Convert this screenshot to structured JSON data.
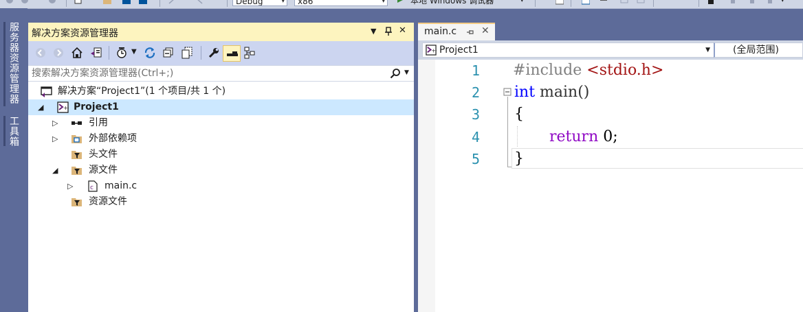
{
  "toolbar": {
    "config": "Debug",
    "platform": "x86",
    "debugger": "本地 Windows 调试器"
  },
  "left_strip": {
    "server_explorer": "服务器资源管理器",
    "toolbox": "工具箱"
  },
  "solution_explorer": {
    "title": "解决方案资源管理器",
    "search_placeholder": "搜索解决方案资源管理器(Ctrl+;)",
    "tree": [
      {
        "label": "解决方案“Project1”(1 个项目/共 1 个)",
        "icon": "solution-icon",
        "expander": ""
      },
      {
        "label": "Project1",
        "icon": "cpp-project-icon",
        "expander": "expanded",
        "selected": true
      },
      {
        "label": "引用",
        "icon": "references-icon",
        "expander": "collapsed"
      },
      {
        "label": "外部依赖项",
        "icon": "external-deps-icon",
        "expander": "collapsed"
      },
      {
        "label": "头文件",
        "icon": "filter-folder-icon",
        "expander": ""
      },
      {
        "label": "源文件",
        "icon": "filter-folder-icon",
        "expander": "expanded"
      },
      {
        "label": "main.c",
        "icon": "c-file-icon",
        "expander": "collapsed"
      },
      {
        "label": "资源文件",
        "icon": "filter-folder-icon",
        "expander": ""
      }
    ]
  },
  "editor": {
    "tab_label": "main.c",
    "project_combo": "Project1",
    "scope_combo": "(全局范围)",
    "line_numbers": [
      "1",
      "2",
      "3",
      "4",
      "5"
    ],
    "code": {
      "l1_directive": "#include ",
      "l1_header": "<stdio.h>",
      "l2_type": "int",
      "l2_rest": " main()",
      "l3": "{",
      "l4_keyword": "return",
      "l4_rest": " 0;",
      "l5": "}"
    }
  },
  "colors": {
    "chrome": "#5d6b99",
    "panel_title_active": "#fdf4bf",
    "toolbar_bg": "#ccd5f0",
    "selection": "#cce8ff",
    "line_number": "#2b91af",
    "keyword": "#0000ff",
    "string": "#a31515",
    "preprocessor": "#808080",
    "control_keyword": "#8f08c4"
  }
}
